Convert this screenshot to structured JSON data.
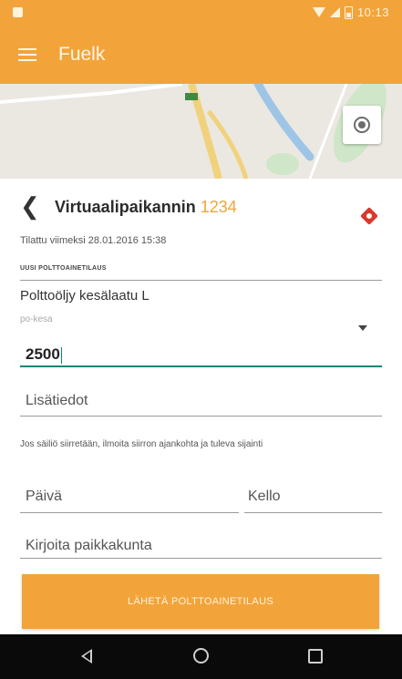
{
  "status_bar": {
    "time": "10:13"
  },
  "toolbar": {
    "title": "Fuelk"
  },
  "station": {
    "title": "Virtuaalipaikannin",
    "id": "1234",
    "ordered_info": "Tilattu viimeksi 28.01.2016 15:38"
  },
  "order": {
    "section_label": "UUSI POLTTOAINETILAUS",
    "product": "Polttoöljy kesälaatu L",
    "product_code": "po-kesa",
    "quantity": "2500",
    "extra_info_placeholder": "Lisätiedot",
    "note": "Jos säiliö siirretään, ilmoita siirron ajankohta ja tuleva sijainti",
    "day_placeholder": "Päivä",
    "time_placeholder": "Kello",
    "place_placeholder": "Kirjoita paikkakunta",
    "submit_label": "LÄHETÄ POLTTOAINETILAUS"
  },
  "colors": {
    "accent": "#f2a43a",
    "focus": "#00897b"
  },
  "icons": [
    "menu-icon",
    "my-location-icon",
    "back-arrow-icon",
    "brand-icon",
    "dropdown-arrow-icon",
    "nav-back-icon",
    "nav-home-icon",
    "nav-recents-icon"
  ]
}
